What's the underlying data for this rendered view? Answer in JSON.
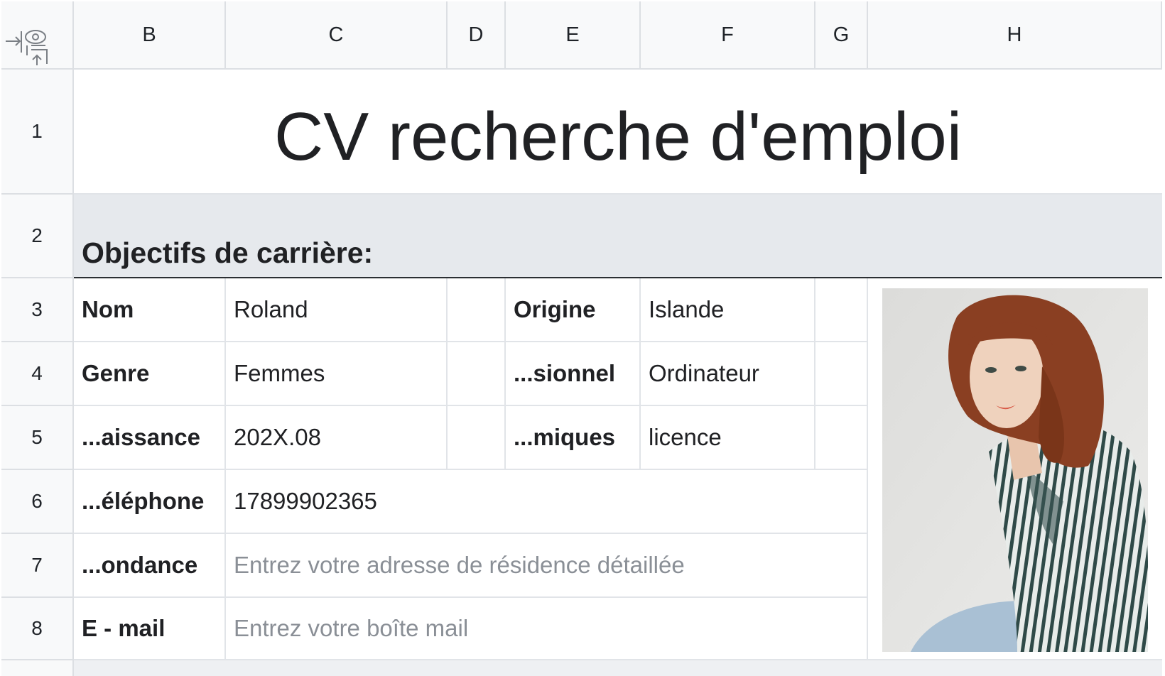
{
  "columns": [
    "B",
    "C",
    "D",
    "E",
    "F",
    "G",
    "H"
  ],
  "rows": [
    "1",
    "2",
    "3",
    "4",
    "5",
    "6",
    "7",
    "8"
  ],
  "title": "CV recherche d'emploi",
  "section_heading": "Objectifs de carrière:",
  "left_fields": [
    {
      "label": "Nom",
      "value": "Roland"
    },
    {
      "label": "Genre",
      "value": "Femmes"
    },
    {
      "label": "...aissance",
      "value": "202X.08"
    },
    {
      "label": "...éléphone",
      "value": "17899902365"
    },
    {
      "label": "...ondance",
      "value": "Entrez votre adresse de résidence détaillée"
    },
    {
      "label": "E - mail",
      "value": "Entrez votre boîte mail"
    }
  ],
  "right_fields": [
    {
      "label": "Origine",
      "value": "Islande"
    },
    {
      "label": "...sionnel",
      "value": "Ordinateur"
    },
    {
      "label": "...miques",
      "value": "licence"
    }
  ],
  "icons": {
    "corner": "freeze-panes-icon"
  },
  "colors": {
    "header_bg": "#f8f9fa",
    "section_bg": "#e6e9ed",
    "placeholder_text": "#8a8f96"
  }
}
